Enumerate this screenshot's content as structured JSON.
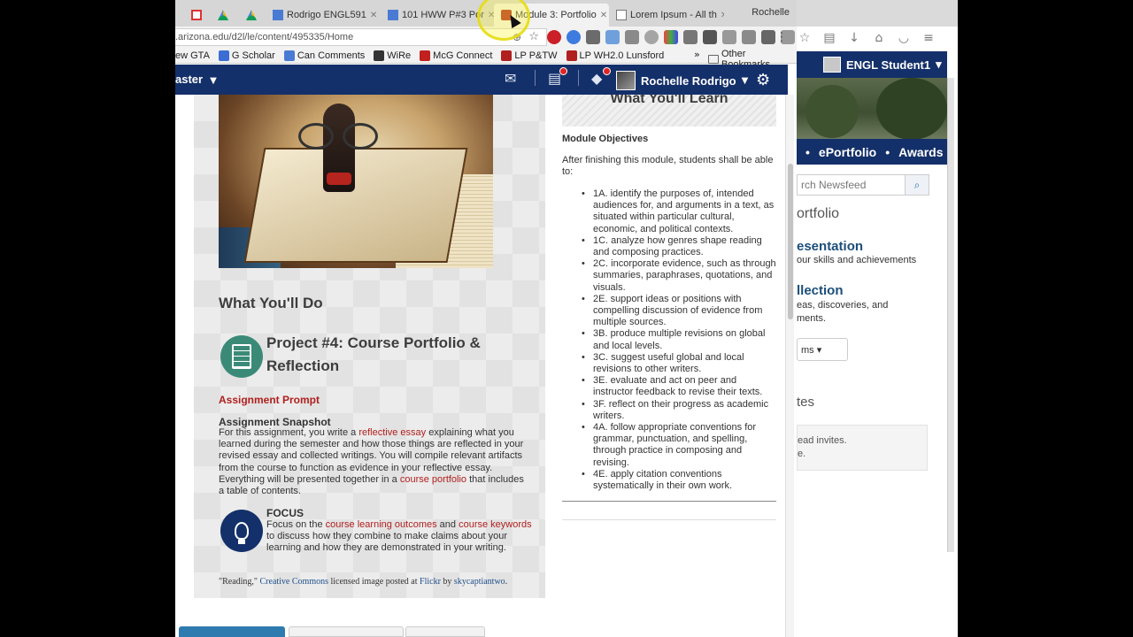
{
  "browser": {
    "tabs": [
      {
        "icon": "gmail-icon",
        "label": ""
      },
      {
        "icon": "drive-icon",
        "label": ""
      },
      {
        "icon": "drive-icon",
        "label": ""
      },
      {
        "icon": "docs-icon",
        "label": "Rodrigo ENGL591"
      },
      {
        "icon": "docs-icon",
        "label": "101 HWW P#3 Por"
      },
      {
        "icon": "arizona-icon",
        "label": "Module 3: Portfolio"
      },
      {
        "icon": "doc-icon",
        "label": "Lorem Ipsum - All th"
      }
    ],
    "profile": "Rochelle",
    "url": ".arizona.edu/d2l/le/content/495335/Home",
    "bookmarks": [
      {
        "label": "ew GTA",
        "color": "#2a4a8a"
      },
      {
        "label": "G Scholar",
        "color": "#3b6dd4"
      },
      {
        "label": "Can Comments",
        "color": "#4a7bd4"
      },
      {
        "label": "WiRe",
        "color": "#333333"
      },
      {
        "label": "McG Connect",
        "color": "#c0201e"
      },
      {
        "label": "LP P&TW",
        "color": "#b0201e"
      },
      {
        "label": "LP WH2.0 Lunsford",
        "color": "#b0201e"
      }
    ],
    "other_bookmarks": "Other Bookmarks"
  },
  "navbar": {
    "course_menu": "aster",
    "user_name": "Rochelle Rodrigo"
  },
  "left": {
    "what_do": "What You'll Do",
    "project_title": "Project #4: Course Portfolio & Reflection",
    "assignment_prompt": "Assignment Prompt",
    "snapshot_heading": "Assignment Snapshot",
    "snapshot": {
      "t1": "For this assignment, you write a ",
      "l1": "reflective essay",
      "t2": " explaining what you learned during the semester and how those things are reflected in your revised essay and collected writings. You will compile relevant artifacts from the course to function as evidence in your reflective essay. Everything will be presented together in a ",
      "l2": "course portfolio",
      "t3": " that includes a table of contents."
    },
    "focus_heading": "FOCUS",
    "focus": {
      "t1": "Focus on the ",
      "l1": "course learning outcomes",
      "t2": " and ",
      "l2": "course keywords",
      "t3": " to discuss how they combine to make claims about your learning and how they are demonstrated in your writing."
    },
    "credit": {
      "q": "\"Reading,\"",
      "cc": "Creative Commons",
      "t1": " licensed image posted at ",
      "flickr": "Flickr",
      "t2": " by ",
      "author": "skycaptiantwo",
      "end": "."
    }
  },
  "right": {
    "learn_title": "What You'll Learn",
    "module_objectives": "Module Objectives",
    "intro": "After finishing this module, students shall be able to:",
    "objectives": [
      "1A. identify the purposes of, intended audiences for, and arguments in a text, as situated within particular cultural, economic, and political contexts.",
      "1C. analyze how genres shape reading and composing practices.",
      "2C. incorporate evidence, such as through summaries, paraphrases, quotations, and visuals.",
      "2E. support ideas or positions with compelling discussion of evidence from multiple sources.",
      "3B. produce multiple revisions on global and local levels.",
      "3C. suggest useful global and local revisions to other writers.",
      "3E. evaluate and act on peer and instructor feedback to revise their texts.",
      "3F. reflect on their progress as academic writers.",
      "4A. follow appropriate conventions for grammar, punctuation, and spelling, through practice in composing and revising.",
      "4E. apply citation conventions systematically in their own work."
    ]
  },
  "back_window": {
    "user": "ENGL Student1",
    "nav": [
      "•",
      "ePortfolio",
      "•",
      "Awards"
    ],
    "search_placeholder": "rch Newsfeed",
    "portfolio": "ortfolio",
    "presentation": "esentation",
    "presentation_desc": "our skills and achievements",
    "collection": "llection",
    "collection_desc_1": "eas, discoveries, and",
    "collection_desc_2": "ments.",
    "items_btn": "ms",
    "invites": "tes",
    "invites_desc_1": "ead invites.",
    "invites_desc_2": "e."
  },
  "colors": {
    "navy": "#14306a",
    "link_red": "#b0201e",
    "teal": "#3b8a78"
  }
}
